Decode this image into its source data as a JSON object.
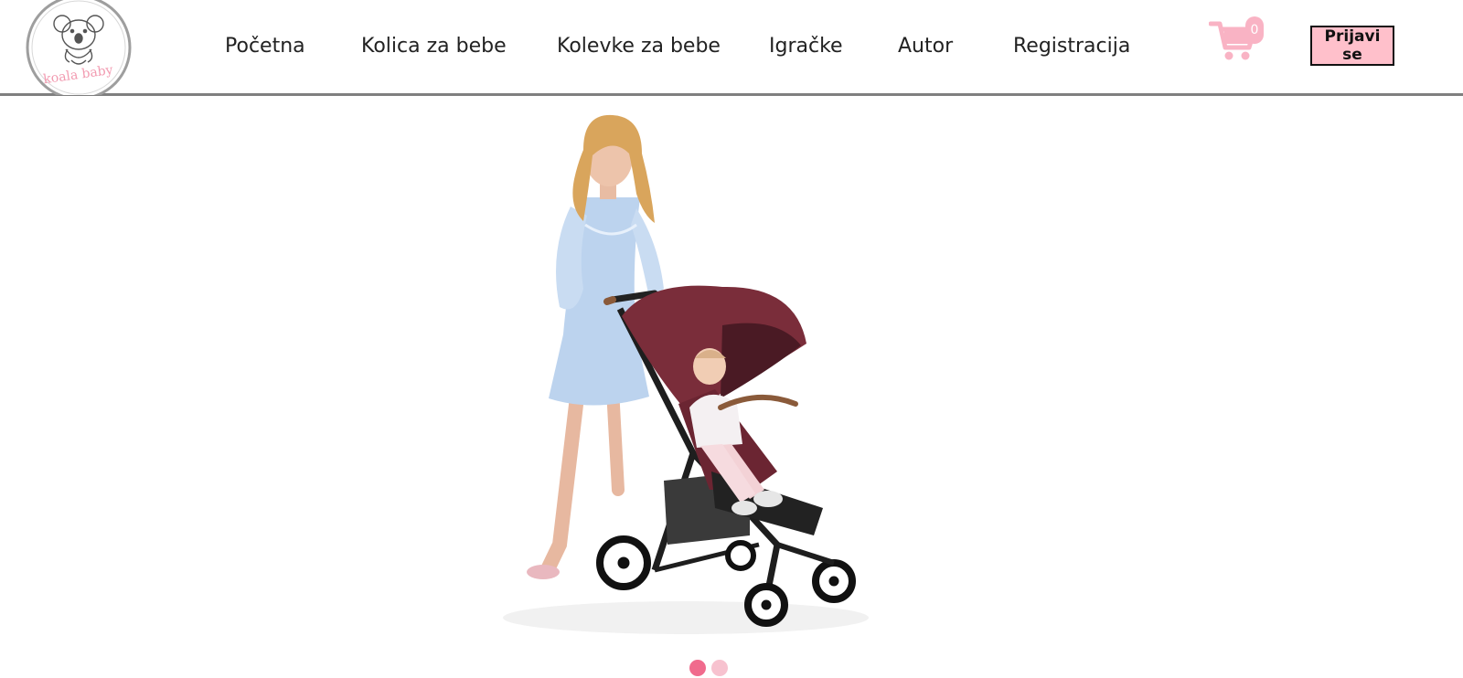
{
  "logo": {
    "text": "koala baby",
    "icon": "koala-icon"
  },
  "nav": {
    "items": [
      {
        "label": "Početna"
      },
      {
        "label": "Kolica za bebe"
      },
      {
        "label": "Kolevke za bebe"
      },
      {
        "label": "Igračke"
      },
      {
        "label": "Autor"
      },
      {
        "label": "Registracija"
      }
    ]
  },
  "cart": {
    "count": "0",
    "icon": "shopping-cart-icon"
  },
  "auth": {
    "login_label": "Prijavi se"
  },
  "colors": {
    "accent_pink": "#ffc0cb",
    "cart_pink": "#f9b3c4",
    "dot_active": "#f06b8d",
    "dot_inactive": "#f7c2cf",
    "stroller_maroon": "#7a2d3a",
    "header_border": "#7f7f7f"
  },
  "carousel": {
    "slide_count": 2,
    "active_index": 0
  }
}
